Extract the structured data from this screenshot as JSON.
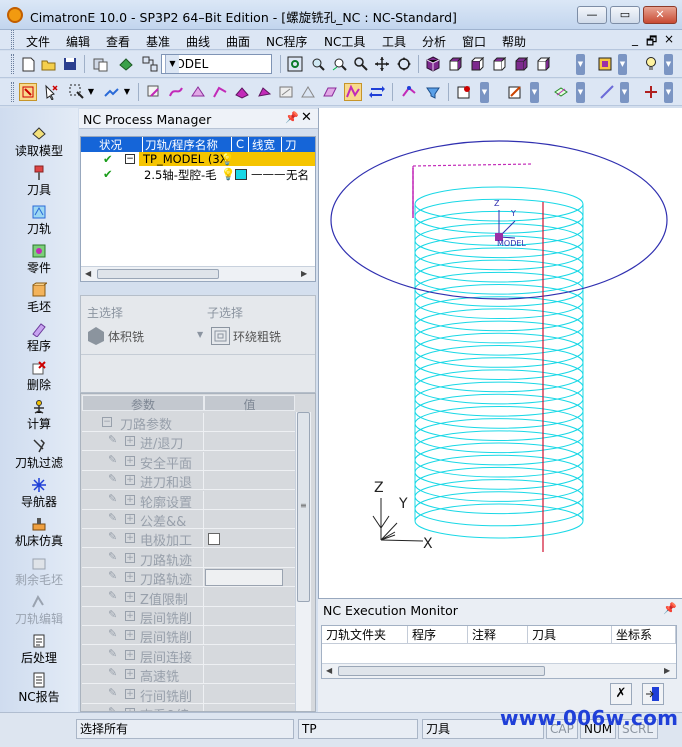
{
  "window": {
    "title": "CimatronE 10.0 - SP3P2 64–Bit Edition - [螺旋铣孔_NC : NC-Standard]",
    "minimize": "—",
    "maximize": "▭",
    "close": "✕"
  },
  "menu": {
    "items": [
      "文件",
      "编辑",
      "查看",
      "基准",
      "曲线",
      "曲面",
      "NC程序",
      "NC工具",
      "工具",
      "分析",
      "窗口",
      "帮助"
    ],
    "mdi_min": "_",
    "mdi_restore": "🗗",
    "mdi_close": "×"
  },
  "toolbar": {
    "model_combo": "MODEL"
  },
  "sidebar": {
    "items": [
      {
        "label": "读取模型",
        "icon": "load-model-icon",
        "disabled": false
      },
      {
        "label": "刀具",
        "icon": "tool-icon",
        "disabled": false
      },
      {
        "label": "刀轨",
        "icon": "toolpath-icon",
        "disabled": false
      },
      {
        "label": "零件",
        "icon": "part-icon",
        "disabled": false
      },
      {
        "label": "毛坯",
        "icon": "stock-icon",
        "disabled": false
      },
      {
        "label": "程序",
        "icon": "procedure-icon",
        "disabled": false
      },
      {
        "label": "删除",
        "icon": "delete-icon",
        "disabled": false
      },
      {
        "label": "计算",
        "icon": "calculate-icon",
        "disabled": false
      },
      {
        "label": "刀轨过滤",
        "icon": "filter-icon",
        "disabled": false
      },
      {
        "label": "导航器",
        "icon": "navigator-icon",
        "disabled": false
      },
      {
        "label": "机床仿真",
        "icon": "machine-sim-icon",
        "disabled": false
      },
      {
        "label": "剩余毛坯",
        "icon": "remaining-stock-icon",
        "disabled": true
      },
      {
        "label": "刀轨编辑",
        "icon": "toolpath-edit-icon",
        "disabled": true
      },
      {
        "label": "后处理",
        "icon": "post-process-icon",
        "disabled": false
      },
      {
        "label": "NC报告",
        "icon": "nc-report-icon",
        "disabled": false
      }
    ]
  },
  "process_manager": {
    "title": "NC Process Manager",
    "columns": [
      "状况",
      "刀轨/程序名称",
      "C",
      "线宽",
      "刀"
    ],
    "rows": [
      {
        "name": "TP_MODEL (3X",
        "selected": true
      },
      {
        "name": "2.5轴-型腔-毛",
        "line": "———",
        "extra": "无名"
      }
    ]
  },
  "selection": {
    "main_label": "主选择",
    "sub_label": "子选择",
    "main_value": "体积铣",
    "sub_value": "环绕粗铣"
  },
  "parameters": {
    "col_param": "参数",
    "col_value": "值",
    "rows": [
      "刀路参数",
      "进/退刀",
      "安全平面",
      "进刀和退",
      "轮廓设置",
      "公差&&",
      "电极加工",
      "刀路轨迹",
      "刀路轨迹",
      "Z值限制",
      "层间铣削",
      "层间铣削",
      "层间连接",
      "高速铣",
      "行间铣削",
      "查看&编"
    ]
  },
  "viewport": {
    "origin_label": "MODEL",
    "axis_z": "Z",
    "axis_y": "Y",
    "axis_x": "X"
  },
  "exec_monitor": {
    "title": "NC Execution Monitor",
    "columns": [
      "刀轨文件夹",
      "程序",
      "注释",
      "刀具",
      "坐标系"
    ]
  },
  "status": {
    "left": "选择所有",
    "mid": "TP",
    "tool": "刀具",
    "cap": "CAP",
    "num": "NUM",
    "scrl": "SCRL"
  },
  "watermark": "www.006w.com",
  "colors": {
    "helix": "#19d8e6",
    "circle": "#3030b0",
    "highlight_row": "#f5c400",
    "selection_bar": "#1565d8"
  }
}
